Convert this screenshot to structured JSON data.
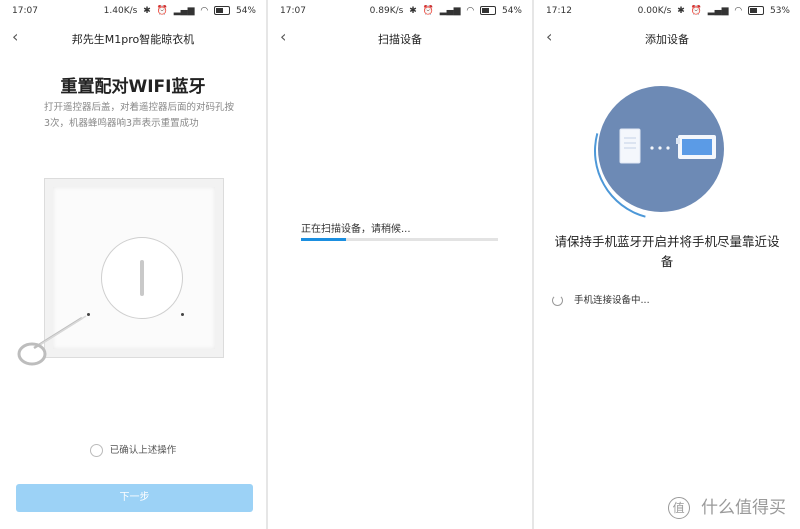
{
  "screen1": {
    "status": {
      "time": "17:07",
      "speed": "1.40K/s",
      "battery": "54%"
    },
    "title": "邦先生M1pro智能晾衣机",
    "heading": "重置配对WIFI蓝牙",
    "instructions": "打开遥控器后盖，对着遥控器后面的对码孔按3次，机器蜂鸣器响3声表示重置成功",
    "confirm_label": "已确认上述操作",
    "next_button": "下一步"
  },
  "screen2": {
    "status": {
      "time": "17:07",
      "speed": "0.89K/s",
      "battery": "54%"
    },
    "title": "扫描设备",
    "scanning_text": "正在扫描设备，请稍候...",
    "progress": 0.23
  },
  "screen3": {
    "status": {
      "time": "17:12",
      "speed": "0.00K/s",
      "battery": "53%"
    },
    "title": "添加设备",
    "prompt": "请保持手机蓝牙开启并将手机尽量靠近设备",
    "connecting": "手机连接设备中..."
  },
  "icons": {
    "back": "chevron-left-icon",
    "phone": "phone-icon",
    "device": "device-icon",
    "pin": "eject-pin-icon"
  },
  "colors": {
    "accent": "#1b8fe0",
    "button_disabled": "#9cd2f6",
    "circle": "#6d8ab5"
  },
  "watermark": "什么值得买"
}
